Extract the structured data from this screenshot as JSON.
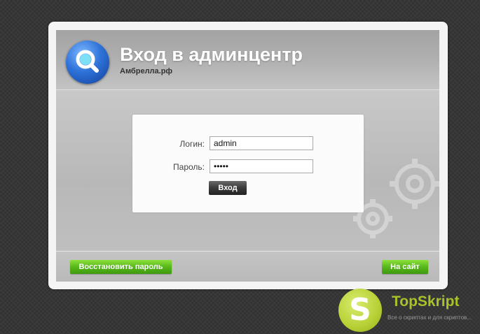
{
  "header": {
    "title": "Вход в админцентр",
    "subtitle": "Амбрелла.рф",
    "logo_icon": "search-icon"
  },
  "login": {
    "login_label": "Логин:",
    "login_value": "admin",
    "password_label": "Пароль:",
    "password_value": "admin",
    "submit_label": "Вход"
  },
  "footer": {
    "restore_label": "Восстановить пароль",
    "to_site_label": "На сайт"
  },
  "watermark": {
    "letter": "S",
    "name": "TopSkript",
    "tagline": "Все о скриптах и для скриптов..."
  },
  "colors": {
    "accent_green": "#58b71a",
    "header_blue": "#2f73d9",
    "watermark_green": "#a9c22a"
  }
}
